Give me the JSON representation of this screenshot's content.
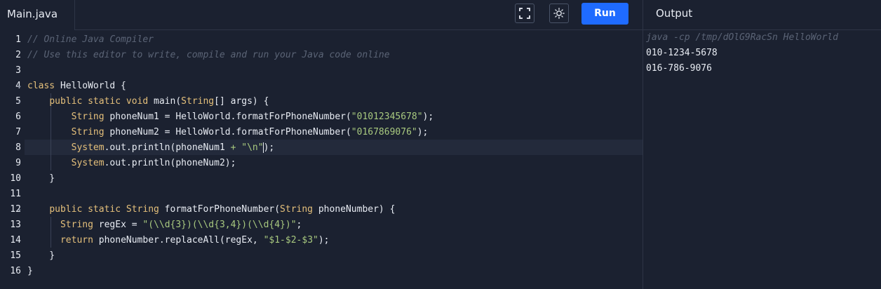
{
  "tabs": {
    "file": "Main.java",
    "output": "Output"
  },
  "toolbar": {
    "run_label": "Run",
    "fullscreen_icon": "fullscreen-icon",
    "theme_icon": "sun-icon"
  },
  "editor": {
    "line_numbers": [
      "1",
      "2",
      "3",
      "4",
      "5",
      "6",
      "7",
      "8",
      "9",
      "10",
      "11",
      "12",
      "13",
      "14",
      "15",
      "16"
    ],
    "active_line": 8,
    "lines": [
      [
        {
          "t": "// Online Java Compiler",
          "c": "cm"
        }
      ],
      [
        {
          "t": "// Use this editor to write, compile and run your Java code online",
          "c": "cm"
        }
      ],
      [],
      [
        {
          "t": "class",
          "c": "kw"
        },
        {
          "t": " HelloWorld {",
          "c": "pl"
        }
      ],
      [
        {
          "t": "    ",
          "c": "pl"
        },
        {
          "t": "public static void",
          "c": "kw"
        },
        {
          "t": " main(",
          "c": "pl"
        },
        {
          "t": "String",
          "c": "ty"
        },
        {
          "t": "[] args) {",
          "c": "pl"
        }
      ],
      [
        {
          "t": "        ",
          "c": "pl"
        },
        {
          "t": "String",
          "c": "ty"
        },
        {
          "t": " phoneNum1 = HelloWorld.formatForPhoneNumber(",
          "c": "pl"
        },
        {
          "t": "\"01012345678\"",
          "c": "str"
        },
        {
          "t": ");",
          "c": "pl"
        }
      ],
      [
        {
          "t": "        ",
          "c": "pl"
        },
        {
          "t": "String",
          "c": "ty"
        },
        {
          "t": " phoneNum2 = HelloWorld.formatForPhoneNumber(",
          "c": "pl"
        },
        {
          "t": "\"0167869076\"",
          "c": "str"
        },
        {
          "t": ");",
          "c": "pl"
        }
      ],
      [
        {
          "t": "        ",
          "c": "pl"
        },
        {
          "t": "System",
          "c": "ty"
        },
        {
          "t": ".out.println(phoneNum1 ",
          "c": "pl"
        },
        {
          "t": "+",
          "c": "op"
        },
        {
          "t": " ",
          "c": "pl"
        },
        {
          "t": "\"\\n\"",
          "c": "str"
        },
        {
          "t": ");",
          "c": "pl"
        }
      ],
      [
        {
          "t": "        ",
          "c": "pl"
        },
        {
          "t": "System",
          "c": "ty"
        },
        {
          "t": ".out.println(phoneNum2);",
          "c": "pl"
        }
      ],
      [
        {
          "t": "    }",
          "c": "pl"
        }
      ],
      [],
      [
        {
          "t": "    ",
          "c": "pl"
        },
        {
          "t": "public static",
          "c": "kw"
        },
        {
          "t": " ",
          "c": "pl"
        },
        {
          "t": "String",
          "c": "ty"
        },
        {
          "t": " formatForPhoneNumber(",
          "c": "pl"
        },
        {
          "t": "String",
          "c": "ty"
        },
        {
          "t": " phoneNumber) {",
          "c": "pl"
        }
      ],
      [
        {
          "t": "      ",
          "c": "pl"
        },
        {
          "t": "String",
          "c": "ty"
        },
        {
          "t": " regEx = ",
          "c": "pl"
        },
        {
          "t": "\"(\\\\d{3})(\\\\d{3,4})(\\\\d{4})\"",
          "c": "str"
        },
        {
          "t": ";",
          "c": "pl"
        }
      ],
      [
        {
          "t": "      ",
          "c": "pl"
        },
        {
          "t": "return",
          "c": "kw"
        },
        {
          "t": " phoneNumber.replaceAll(regEx, ",
          "c": "pl"
        },
        {
          "t": "\"$1-$2-$3\"",
          "c": "str"
        },
        {
          "t": ");",
          "c": "pl"
        }
      ],
      [
        {
          "t": "    }",
          "c": "pl"
        }
      ],
      [
        {
          "t": "}",
          "c": "pl"
        }
      ]
    ]
  },
  "output": {
    "command": "java -cp /tmp/dOlG9RacSn HelloWorld",
    "lines": [
      "010-1234-5678",
      "016-786-9076"
    ]
  },
  "colors": {
    "background": "#1b2130",
    "run_button": "#1f6bff",
    "keyword": "#e5c07b",
    "string": "#a8c97f",
    "comment": "#5b6476"
  }
}
